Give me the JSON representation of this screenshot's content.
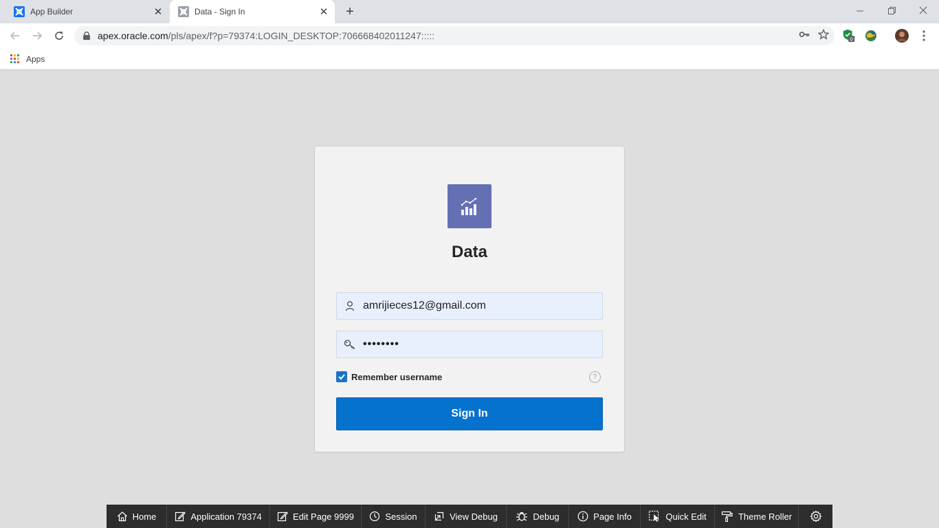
{
  "browser": {
    "tabs": [
      {
        "title": "App Builder",
        "active": false
      },
      {
        "title": "Data - Sign In",
        "active": true
      }
    ],
    "url_domain": "apex.oracle.com",
    "url_path": "/pls/apex/f?p=79374:LOGIN_DESKTOP:706668402011247:::::",
    "bookmarks": {
      "apps_label": "Apps"
    },
    "extension_badge": "0"
  },
  "login": {
    "app_title": "Data",
    "username": "amrijieces12@gmail.com",
    "password_mask": "••••••••",
    "remember_label": "Remember username",
    "remember_checked": true,
    "help_glyph": "?",
    "signin_label": "Sign In"
  },
  "dev_toolbar": {
    "items": [
      {
        "label": "Home",
        "icon": "home-icon"
      },
      {
        "label": "Application 79374",
        "icon": "edit-app-icon"
      },
      {
        "label": "Edit Page 9999",
        "icon": "edit-page-icon"
      },
      {
        "label": "Session",
        "icon": "clock-icon"
      },
      {
        "label": "View Debug",
        "icon": "view-debug-icon"
      },
      {
        "label": "Debug",
        "icon": "bug-icon"
      },
      {
        "label": "Page Info",
        "icon": "info-icon"
      },
      {
        "label": "Quick Edit",
        "icon": "quick-edit-icon"
      },
      {
        "label": "Theme Roller",
        "icon": "paint-roller-icon"
      },
      {
        "label": "",
        "icon": "gear-icon"
      }
    ]
  },
  "colors": {
    "primary_button": "#0572ce",
    "logo_bg": "#6470b3",
    "page_bg": "#dedede",
    "devbar_bg": "#2d2d2d"
  }
}
